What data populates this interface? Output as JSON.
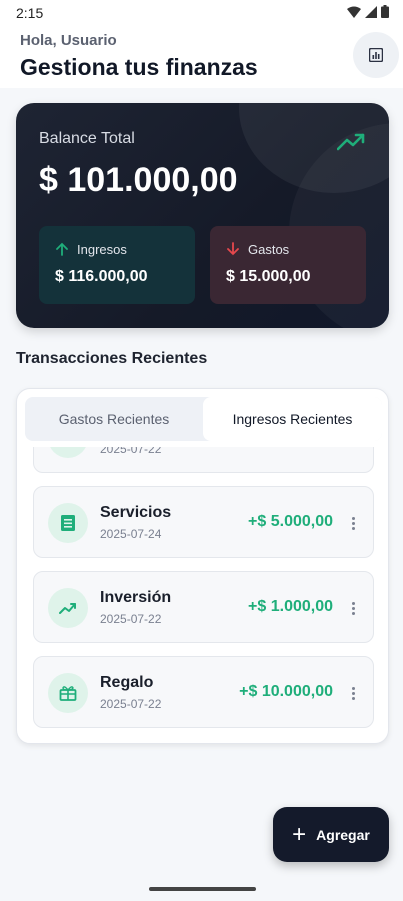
{
  "status": {
    "time": "2:15"
  },
  "header": {
    "greeting": "Hola, Usuario",
    "title": "Gestiona tus finanzas",
    "stats_icon": "bar-chart-icon"
  },
  "balance": {
    "label": "Balance Total",
    "value": "$ 101.000,00",
    "income_label": "Ingresos",
    "income_value": "$ 116.000,00",
    "expense_label": "Gastos",
    "expense_value": "$ 15.000,00"
  },
  "transactions": {
    "section_title": "Transacciones Recientes",
    "tabs": [
      {
        "label": "Gastos Recientes",
        "selected": false
      },
      {
        "label": "Ingresos Recientes",
        "selected": true
      }
    ],
    "items": [
      {
        "name": "",
        "date": "2025-07-22",
        "amount": "",
        "icon": "generic-icon"
      },
      {
        "name": "Servicios",
        "date": "2025-07-24",
        "amount": "+$ 5.000,00",
        "icon": "receipt-icon"
      },
      {
        "name": "Inversión",
        "date": "2025-07-22",
        "amount": "+$ 1.000,00",
        "icon": "trending-up-icon"
      },
      {
        "name": "Regalo",
        "date": "2025-07-22",
        "amount": "+$ 10.000,00",
        "icon": "gift-icon"
      }
    ]
  },
  "fab": {
    "label": "Agregar"
  },
  "colors": {
    "accent_green": "#1fae7a",
    "expense_red": "#e5484d",
    "dark_card": "#151a28"
  }
}
